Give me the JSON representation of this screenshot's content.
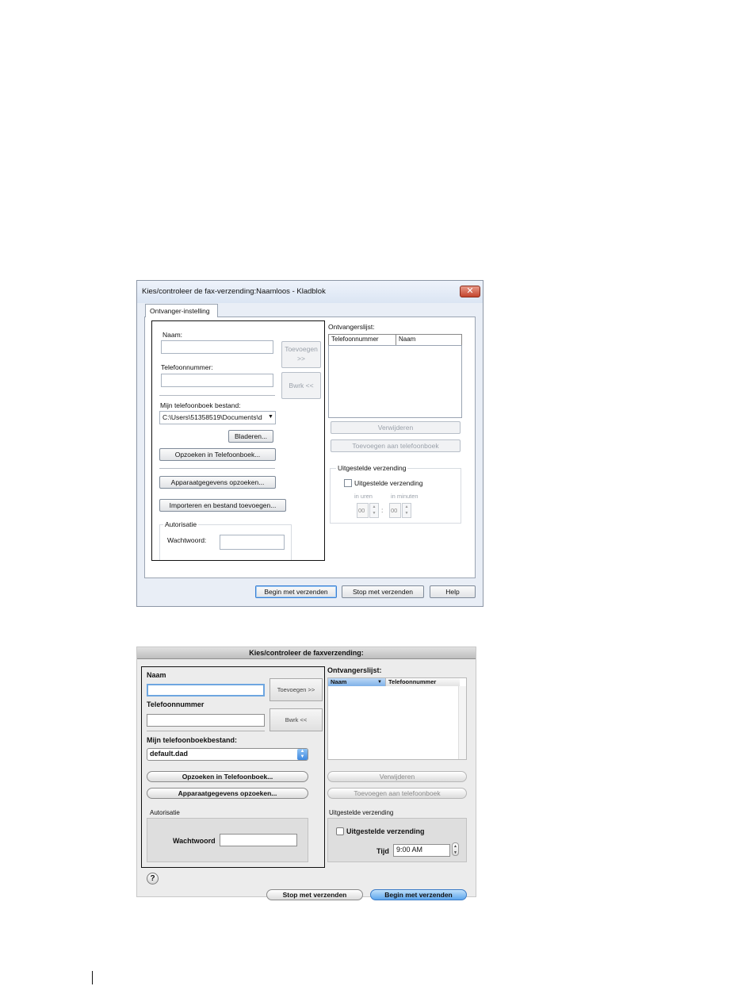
{
  "windows_dialog": {
    "title": "Kies/controleer de fax-verzending:Naamloos - Kladblok",
    "close_glyph": "✕",
    "tab_label": "Ontvanger-instelling",
    "name_label": "Naam:",
    "name_value": "",
    "phone_label": "Telefoonnummer:",
    "phone_value": "",
    "add_button": "Toevoegen >>",
    "remove_button": "Bwrk <<",
    "phonebook_file_label": "Mijn telefoonboek bestand:",
    "phonebook_file_value": "C:\\Users\\51358519\\Documents\\d",
    "browse_button": "Bladeren...",
    "lookup_phonebook_button": "Opzoeken in Telefoonboek...",
    "lookup_device_button": "Apparaatgegevens opzoeken...",
    "import_button": "Importeren en bestand toevoegen...",
    "auth_group": "Autorisatie",
    "password_label": "Wachtwoord:",
    "password_value": "",
    "recipients_label": "Ontvangerslijst:",
    "recipients_columns": [
      "Telefoonnummer",
      "Naam"
    ],
    "delete_button": "Verwijderen",
    "add_to_phonebook_button": "Toevoegen aan telefoonboek",
    "delayed_group": "Uitgestelde verzending",
    "delayed_checkbox": "Uitgestelde verzending",
    "delayed_checked": false,
    "hours_label": "in uren",
    "minutes_label": "in minuten",
    "hours_value": "00",
    "minutes_value": "00",
    "time_separator": ":",
    "start_button": "Begin met verzenden",
    "stop_button": "Stop met verzenden",
    "help_button": "Help"
  },
  "mac_dialog": {
    "title": "Kies/controleer de faxverzending:",
    "name_label": "Naam",
    "name_value": "",
    "phone_label": "Telefoonnummer",
    "phone_value": "",
    "add_button": "Toevoegen >>",
    "remove_button": "Bwrk <<",
    "phonebook_file_label": "Mijn telefoonboekbestand:",
    "phonebook_file_value": "default.dad",
    "lookup_phonebook_button": "Opzoeken in Telefoonboek...",
    "lookup_device_button": "Apparaatgegevens opzoeken...",
    "auth_group": "Autorisatie",
    "password_label": "Wachtwoord",
    "password_value": "",
    "recipients_label": "Ontvangerslijst:",
    "recipients_columns": [
      "Naam",
      "Telefoonnummer"
    ],
    "sort_glyph": "▼",
    "delete_button": "Verwijderen",
    "add_to_phonebook_button": "Toevoegen aan telefoonboek",
    "delayed_group": "Uitgestelde verzending",
    "delayed_checkbox": "Uitgestelde verzending",
    "delayed_checked": false,
    "time_label": "Tijd",
    "time_value": "9:00 AM",
    "help_glyph": "?",
    "stop_button": "Stop met verzenden",
    "start_button": "Begin met verzenden"
  }
}
